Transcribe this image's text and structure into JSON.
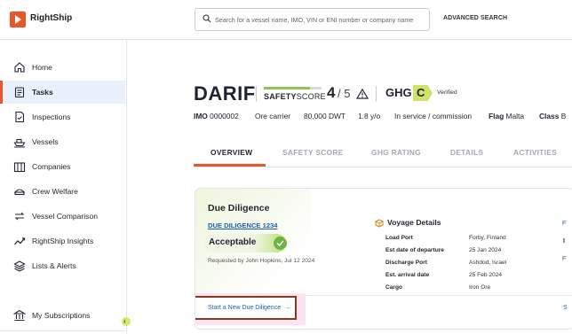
{
  "app": {
    "name": "RightShip",
    "brand_color": "#e8562a"
  },
  "search": {
    "placeholder": "Search for a vessel name, IMO, VIN or ENI number or company name",
    "advanced_label": "ADVANCED SEARCH"
  },
  "sidebar": {
    "items": [
      {
        "label": "Home",
        "icon": "home-icon",
        "active": false
      },
      {
        "label": "Tasks",
        "icon": "tasks-icon",
        "active": true
      },
      {
        "label": "Inspections",
        "icon": "inspection-icon",
        "active": false
      },
      {
        "label": "Vessels",
        "icon": "ship-icon",
        "active": false
      },
      {
        "label": "Companies",
        "icon": "building-icon",
        "active": false
      },
      {
        "label": "Crew Welfare",
        "icon": "crew-icon",
        "active": false
      },
      {
        "label": "Vessel Comparison",
        "icon": "compare-icon",
        "active": false
      },
      {
        "label": "RightShip Insights",
        "icon": "insights-icon",
        "active": false
      },
      {
        "label": "Lists & Alerts",
        "icon": "layers-icon",
        "active": false
      }
    ],
    "subscriptions_label": "My Subscriptions"
  },
  "vessel": {
    "name": "DARIF",
    "safety_score_label_bold": "SAFETY",
    "safety_score_label_thin": "SCORE",
    "safety_score": "4",
    "safety_score_max": "/ 5",
    "safety_score_fraction": 0.8,
    "ghg_label": "GHG",
    "ghg_rating": "C",
    "ghg_color": "#cfe36a",
    "ghg_status": "Verified",
    "imo_label": "IMO",
    "imo": "0000002",
    "type": "Ore carrier",
    "dwt": "80,000 DWT",
    "age": "1.8 y/o",
    "status": "In service / commission",
    "flag_label": "Flag",
    "flag": "Malta",
    "class_label": "Class",
    "class_partial": "B"
  },
  "tabs": [
    "OVERVIEW",
    "SAFETY SCORE",
    "GHG RATING",
    "DETAILS",
    "ACTIVITIES"
  ],
  "due_diligence": {
    "title": "Due Diligence",
    "link": "DUE DILIGENCE 1234",
    "status": "Acceptable",
    "requested": "Requested by John Hopkins, Jul 12 2024",
    "new_action": "Start a New Due Diligence",
    "new_action_arrow": "→"
  },
  "voyage": {
    "title": "Voyage Details",
    "rows": [
      {
        "k": "Load Port",
        "v": "Forby, Finland"
      },
      {
        "k": "Est date of departure",
        "v": "25 Jan 2024"
      },
      {
        "k": "Discharge Port",
        "v": "Ashdod, Israel"
      },
      {
        "k": "Est. arrival date",
        "v": "25 Feb 2024"
      },
      {
        "k": "Cargo",
        "v": "Iron Ore"
      }
    ]
  },
  "edge_glyphs": {
    "a": "F",
    "b": "I",
    "c": "F",
    "d": "S"
  }
}
